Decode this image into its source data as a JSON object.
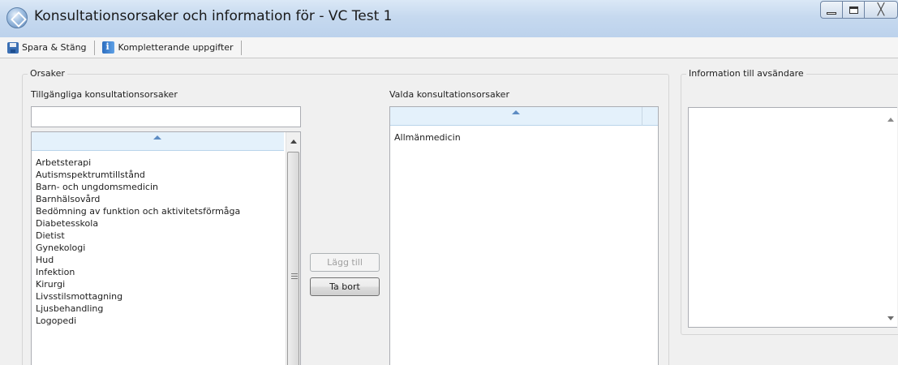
{
  "window": {
    "title": "Konsultationsorsaker och information för - VC Test 1",
    "minimize_label": "",
    "maximize_label": "",
    "close_label": "╳"
  },
  "toolbar": {
    "save_close_label": "Spara & Stäng",
    "additional_info_label": "Kompletterande uppgifter"
  },
  "reasons": {
    "group_title": "Orsaker",
    "available_label": "Tillgängliga konsultationsorsaker",
    "filter_value": "",
    "available_items": [
      "Arbetsterapi",
      "Autismspektrumtillstånd",
      "Barn- och ungdomsmedicin",
      "Barnhälsovård",
      "Bedömning av funktion och aktivitetsförmåga",
      "Diabetesskola",
      "Dietist",
      "Gynekologi",
      "Hud",
      "Infektion",
      "Kirurgi",
      "Livsstilsmottagning",
      "Ljusbehandling",
      "Logopedi"
    ],
    "add_button": "Lägg till",
    "remove_button": "Ta bort",
    "selected_label": "Valda konsultationsorsaker",
    "selected_items": [
      "Allmänmedicin"
    ]
  },
  "info": {
    "group_title": "Information till avsändare",
    "text_value": ""
  }
}
